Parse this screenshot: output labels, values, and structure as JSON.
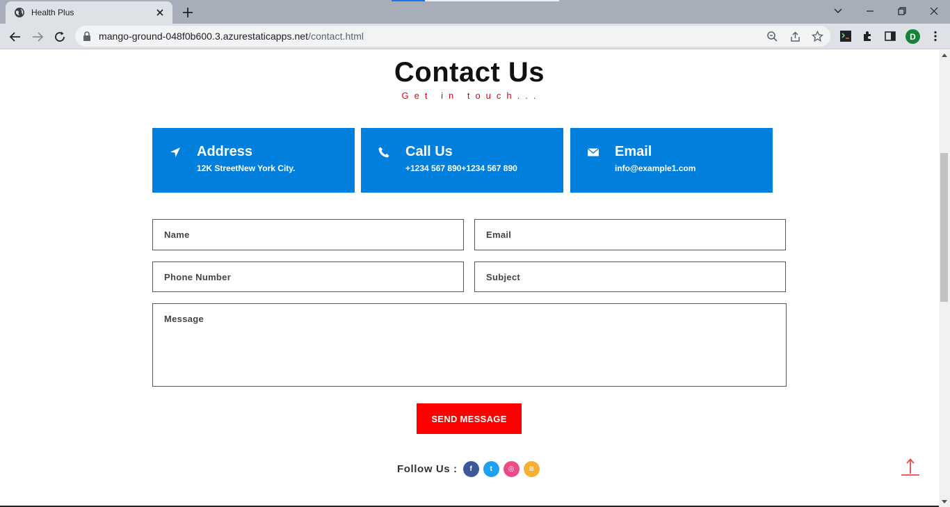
{
  "browser": {
    "tab_title": "Health Plus",
    "url_host": "mango-ground-048f0b600.3.azurestaticapps.net",
    "url_path": "/contact.html",
    "profile_initial": "D"
  },
  "page": {
    "title": "Contact Us",
    "subtitle": "Get in touch...",
    "info_boxes": [
      {
        "icon": "location-arrow-icon",
        "title": "Address",
        "text": "12K StreetNew York City."
      },
      {
        "icon": "phone-icon",
        "title": "Call Us",
        "text": "+1234 567 890+1234 567 890"
      },
      {
        "icon": "envelope-icon",
        "title": "Email",
        "text": "info@example1.com"
      }
    ],
    "form": {
      "name_placeholder": "Name",
      "email_placeholder": "Email",
      "phone_placeholder": "Phone Number",
      "subject_placeholder": "Subject",
      "message_placeholder": "Message",
      "send_label": "SEND MESSAGE"
    },
    "follow": {
      "label": "Follow Us :",
      "networks": [
        {
          "icon": "facebook-icon",
          "glyph": "f",
          "color": "#3b5998"
        },
        {
          "icon": "twitter-icon",
          "glyph": "t",
          "color": "#1da1f2"
        },
        {
          "icon": "dribbble-icon",
          "glyph": "◎",
          "color": "#ea4c89"
        },
        {
          "icon": "rss-icon",
          "glyph": "≋",
          "color": "#f7b034"
        }
      ]
    }
  },
  "colors": {
    "accent_blue": "#0080dc",
    "accent_red": "#ff0000",
    "subtitle_red": "#e3000f"
  }
}
